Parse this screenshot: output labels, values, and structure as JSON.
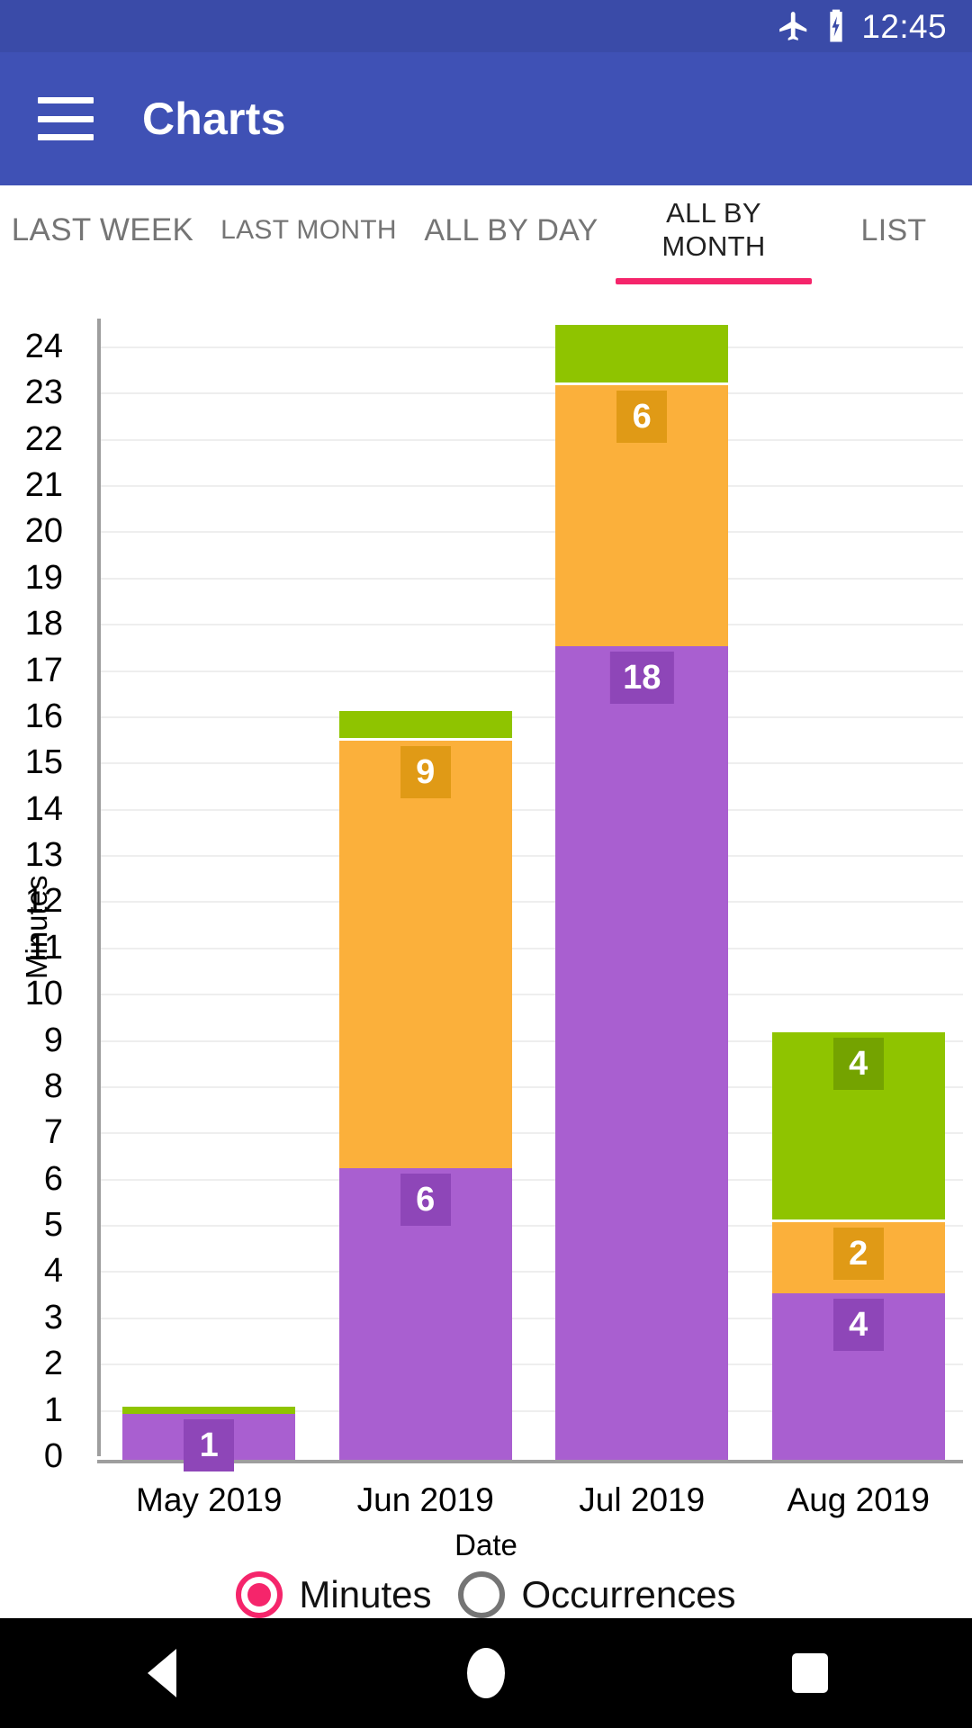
{
  "status_bar": {
    "time": "12:45",
    "icons": [
      "airplane-icon",
      "battery-charging-icon"
    ]
  },
  "app_bar": {
    "menu_icon": "hamburger-menu-icon",
    "title": "Charts"
  },
  "tabs": {
    "items": [
      {
        "label": "LAST WEEK",
        "active": false
      },
      {
        "label": "LAST MONTH",
        "active": false
      },
      {
        "label": "ALL BY DAY",
        "active": false
      },
      {
        "label": "ALL BY MONTH",
        "active": true
      },
      {
        "label": "LIST",
        "active": false
      }
    ],
    "indicator_color": "#F5256B"
  },
  "legend": {
    "options": [
      {
        "label": "Minutes",
        "selected": true
      },
      {
        "label": "Occurrences",
        "selected": false
      }
    ],
    "selected_color": "#F5256B",
    "unselected_color": "#757575"
  },
  "nav_bar": {
    "back": "back-triangle-icon",
    "home": "home-circle-icon",
    "recents": "recents-square-icon"
  },
  "chart_data": {
    "type": "bar",
    "stacked": true,
    "title": "",
    "xlabel": "Date",
    "ylabel": "Minutes",
    "ylim": [
      0,
      24.6
    ],
    "grid": true,
    "legend_position": "bottom",
    "categories": [
      "May 2019",
      "Jun 2019",
      "Jul 2019",
      "Aug 2019"
    ],
    "yticks": [
      0,
      1,
      2,
      3,
      4,
      5,
      6,
      7,
      8,
      9,
      10,
      11,
      12,
      13,
      14,
      15,
      16,
      17,
      18,
      19,
      20,
      21,
      22,
      23,
      24
    ],
    "series": [
      {
        "name": "purple",
        "color": "#A95FD0",
        "label_bg": "#8E46B8",
        "values": [
          1,
          6.3,
          17.6,
          3.6
        ]
      },
      {
        "name": "orange",
        "color": "#FBB03B",
        "label_bg": "#E09A16",
        "values": [
          0,
          9.3,
          5.7,
          1.6
        ]
      },
      {
        "name": "green",
        "color": "#8FC400",
        "label_bg": "#74A300",
        "values": [
          0.2,
          0.65,
          1.3,
          4.1
        ]
      }
    ],
    "bar_labels": [
      {
        "category": "May 2019",
        "purple": "1",
        "orange": "",
        "green": ""
      },
      {
        "category": "Jun 2019",
        "purple": "6",
        "orange": "9",
        "green": ""
      },
      {
        "category": "Jul 2019",
        "purple": "18",
        "orange": "6",
        "green": ""
      },
      {
        "category": "Aug 2019",
        "purple": "4",
        "orange": "2",
        "green": "4"
      }
    ]
  }
}
